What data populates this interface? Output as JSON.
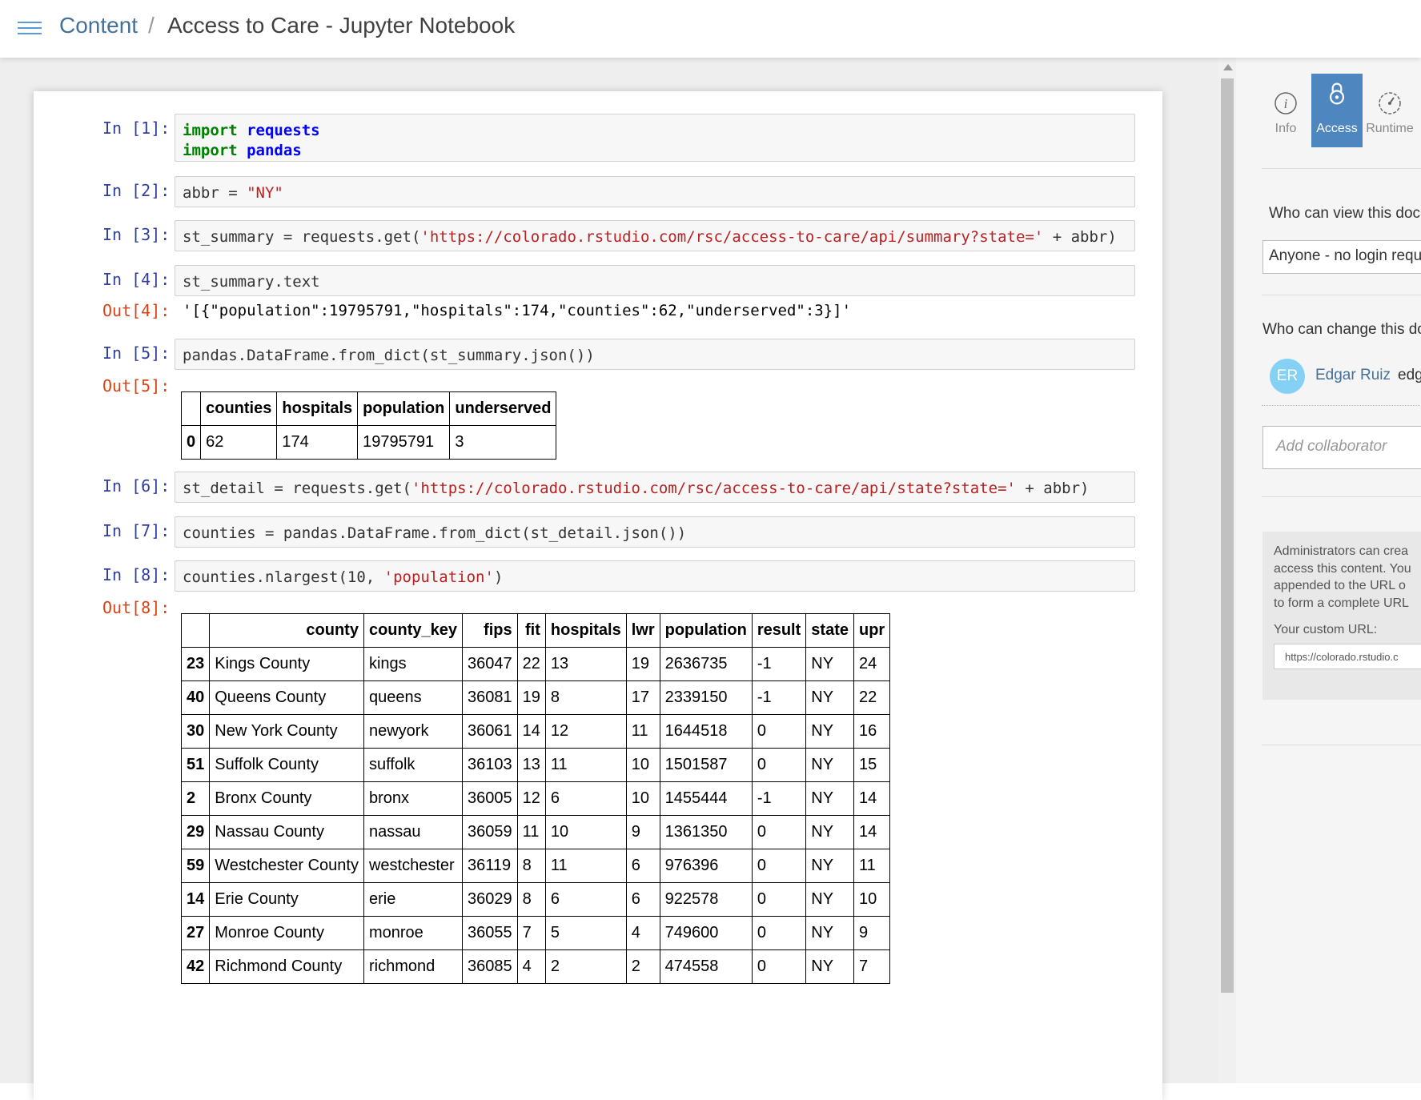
{
  "header": {
    "breadcrumb_link": "Content",
    "separator": "/",
    "title": "Access to Care - Jupyter Notebook"
  },
  "cells": {
    "c1": {
      "prompt": "In [1]:",
      "lines": [
        [
          "import",
          "requests"
        ],
        [
          "import",
          "pandas"
        ]
      ]
    },
    "c2": {
      "prompt": "In [2]:",
      "code_a": "abbr = ",
      "code_str": "\"NY\""
    },
    "c3": {
      "prompt": "In [3]:",
      "code_a": "st_summary = requests.get(",
      "code_str": "'https://colorado.rstudio.com/rsc/access-to-care/api/summary?state='",
      "code_b": " + abbr)"
    },
    "c4": {
      "prompt": "In [4]:",
      "code": "st_summary.text",
      "out_prompt": "Out[4]:",
      "output": "'[{\"population\":19795791,\"hospitals\":174,\"counties\":62,\"underserved\":3}]'"
    },
    "c5": {
      "prompt": "In [5]:",
      "code": "pandas.DataFrame.from_dict(st_summary.json())",
      "out_prompt": "Out[5]:"
    },
    "c6": {
      "prompt": "In [6]:",
      "code_a": "st_detail = requests.get(",
      "code_str": "'https://colorado.rstudio.com/rsc/access-to-care/api/state?state='",
      "code_b": " + abbr)"
    },
    "c7": {
      "prompt": "In [7]:",
      "code": "counties = pandas.DataFrame.from_dict(st_detail.json())"
    },
    "c8": {
      "prompt": "In [8]:",
      "code_a": "counties.nlargest(10, ",
      "code_str": "'population'",
      "code_b": ")",
      "out_prompt": "Out[8]:"
    }
  },
  "summary_table": {
    "columns": [
      "counties",
      "hospitals",
      "population",
      "underserved"
    ],
    "rows": [
      [
        "0",
        "62",
        "174",
        "19795791",
        "3"
      ]
    ]
  },
  "counties_table": {
    "columns": [
      "county",
      "county_key",
      "fips",
      "fit",
      "hospitals",
      "lwr",
      "population",
      "result",
      "state",
      "upr"
    ],
    "rows": [
      [
        "23",
        "Kings County",
        "kings",
        "36047",
        "22",
        "13",
        "19",
        "2636735",
        "-1",
        "NY",
        "24"
      ],
      [
        "40",
        "Queens County",
        "queens",
        "36081",
        "19",
        "8",
        "17",
        "2339150",
        "-1",
        "NY",
        "22"
      ],
      [
        "30",
        "New York County",
        "newyork",
        "36061",
        "14",
        "12",
        "11",
        "1644518",
        "0",
        "NY",
        "16"
      ],
      [
        "51",
        "Suffolk County",
        "suffolk",
        "36103",
        "13",
        "11",
        "10",
        "1501587",
        "0",
        "NY",
        "15"
      ],
      [
        "2",
        "Bronx County",
        "bronx",
        "36005",
        "12",
        "6",
        "10",
        "1455444",
        "-1",
        "NY",
        "14"
      ],
      [
        "29",
        "Nassau County",
        "nassau",
        "36059",
        "11",
        "10",
        "9",
        "1361350",
        "0",
        "NY",
        "14"
      ],
      [
        "59",
        "Westchester County",
        "westchester",
        "36119",
        "8",
        "11",
        "6",
        "976396",
        "0",
        "NY",
        "11"
      ],
      [
        "14",
        "Erie County",
        "erie",
        "36029",
        "8",
        "6",
        "6",
        "922578",
        "0",
        "NY",
        "10"
      ],
      [
        "27",
        "Monroe County",
        "monroe",
        "36055",
        "7",
        "5",
        "4",
        "749600",
        "0",
        "NY",
        "9"
      ],
      [
        "42",
        "Richmond County",
        "richmond",
        "36085",
        "4",
        "2",
        "2",
        "474558",
        "0",
        "NY",
        "7"
      ]
    ]
  },
  "panel": {
    "tabs": [
      {
        "label": "Info",
        "icon": "info-icon"
      },
      {
        "label": "Access",
        "icon": "lock-icon",
        "active": true
      },
      {
        "label": "Runtime",
        "icon": "gauge-icon"
      }
    ],
    "view_label": "Who can view this doc",
    "view_value": "Anyone - no login requ",
    "change_label": "Who can change this do",
    "collaborator": {
      "initials": "ER",
      "name": "Edgar Ruiz",
      "email": "edg"
    },
    "add_placeholder": "Add collaborator",
    "admin_text": "Administrators can crea\naccess this content. You\nappended to the URL o\nto form a complete URL",
    "custom_url_label": "Your custom URL:",
    "custom_url_value": "https://colorado.rstudio.c"
  },
  "colors": {
    "accent": "#4e86bf",
    "link": "#447099",
    "in_prompt": "#303f9f",
    "out_prompt": "#d84315"
  }
}
